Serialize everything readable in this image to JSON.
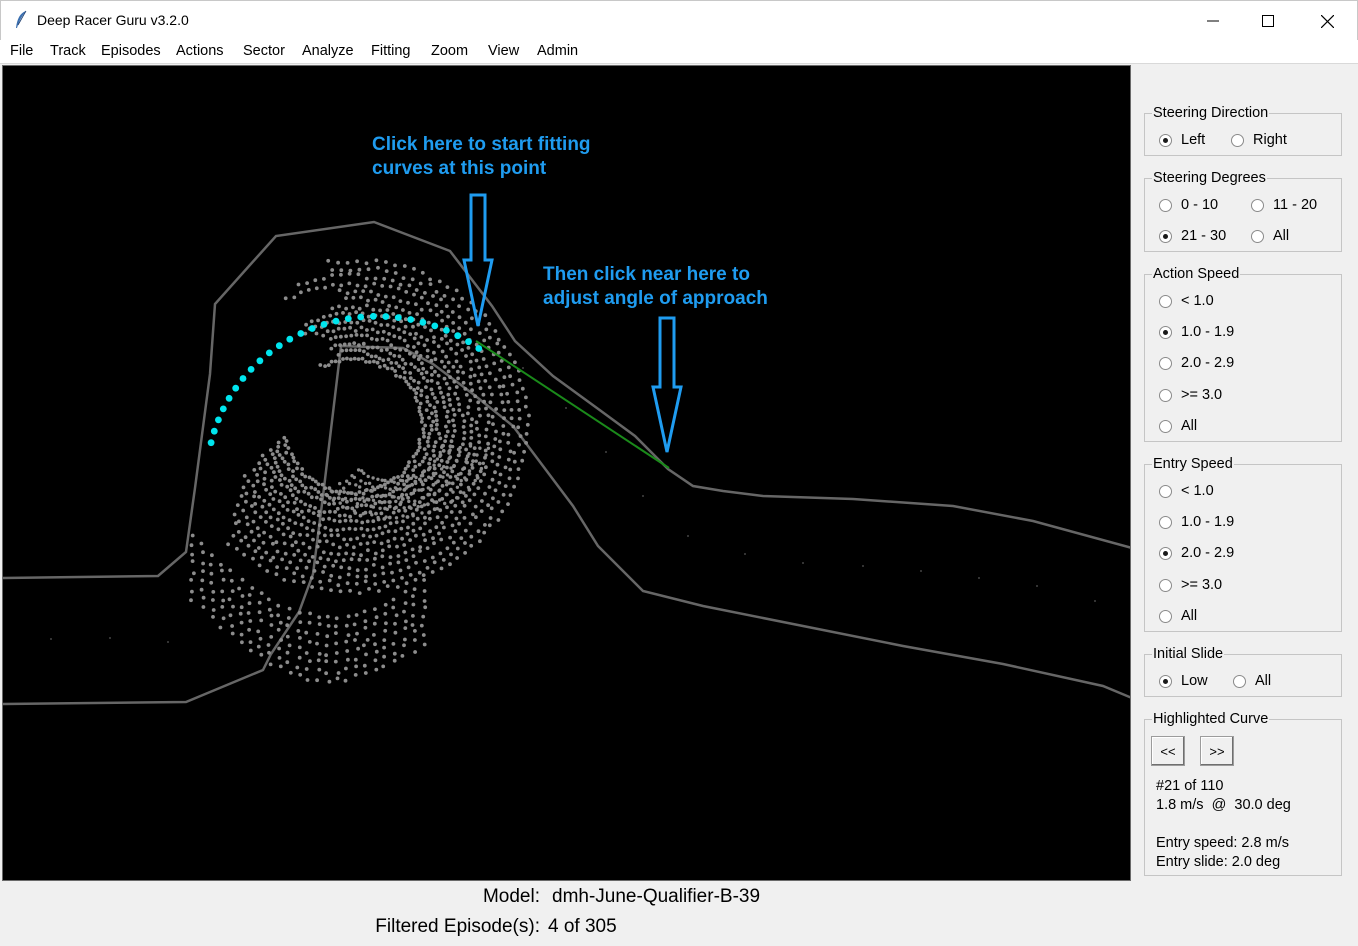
{
  "window": {
    "title": "Deep Racer Guru v3.2.0"
  },
  "menu": [
    "File",
    "Track",
    "Episodes",
    "Actions",
    "Sector",
    "Analyze",
    "Fitting",
    "Zoom",
    "View",
    "Admin"
  ],
  "annotations": {
    "first": [
      "Click here to start fitting",
      "curves at this point"
    ],
    "second": [
      "Then click near here to",
      "adjust angle of approach"
    ]
  },
  "colors": {
    "annotation": "#1f9cf0",
    "highlight_curve": "#00e5ee",
    "approach_line": "#1a8a1a",
    "track_border": "#666666",
    "scatter": "#8c8c8c"
  },
  "filters": {
    "steering_direction": {
      "title": "Steering Direction",
      "options": [
        "Left",
        "Right"
      ],
      "selected": "Left"
    },
    "steering_degrees": {
      "title": "Steering Degrees",
      "options": [
        "0 - 10",
        "11 - 20",
        "21 - 30",
        "All"
      ],
      "selected": "21 - 30"
    },
    "action_speed": {
      "title": "Action Speed",
      "options": [
        "< 1.0",
        "1.0 - 1.9",
        "2.0 - 2.9",
        ">= 3.0",
        "All"
      ],
      "selected": "1.0 - 1.9"
    },
    "entry_speed": {
      "title": "Entry Speed",
      "options": [
        "< 1.0",
        "1.0 - 1.9",
        "2.0 - 2.9",
        ">= 3.0",
        "All"
      ],
      "selected": "2.0 - 2.9"
    },
    "initial_slide": {
      "title": "Initial Slide",
      "options": [
        "Low",
        "All"
      ],
      "selected": "Low"
    }
  },
  "highlighted_curve": {
    "title": "Highlighted Curve",
    "prev_label": "<<",
    "next_label": ">>",
    "position": "#21 of 110",
    "speed_angle": "1.8 m/s  @  30.0 deg",
    "entry_speed": "Entry speed: 2.8 m/s",
    "entry_slide": "Entry slide: 2.0 deg"
  },
  "status": {
    "model_label": "Model:",
    "model_value": "dmh-June-Qualifier-B-39",
    "episodes_label": "Filtered Episode(s):",
    "episodes_value": "4 of 305"
  }
}
